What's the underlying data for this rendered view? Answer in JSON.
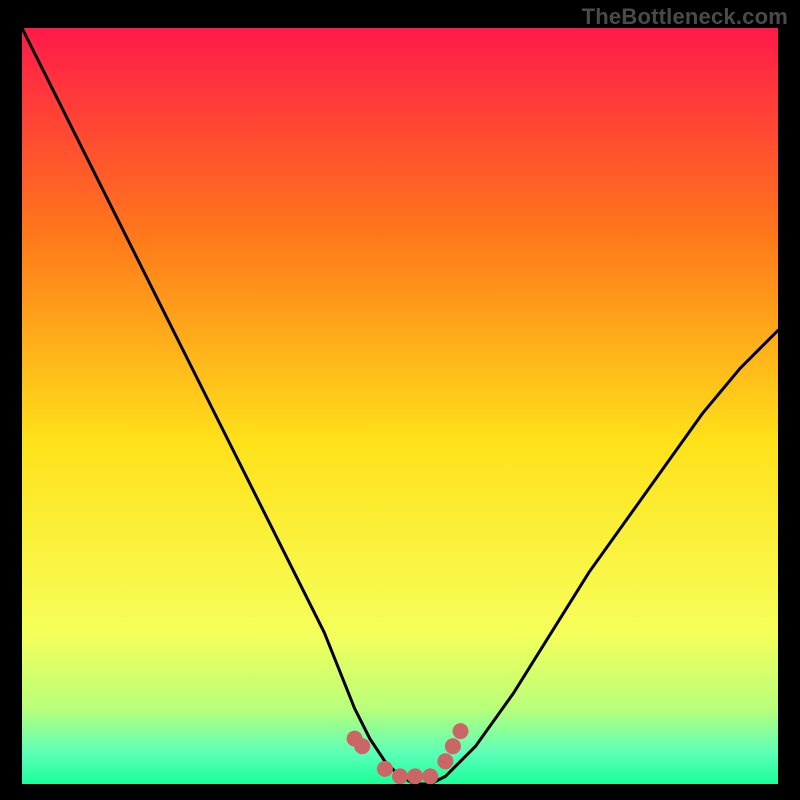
{
  "watermark": "TheBottleneck.com",
  "colors": {
    "frame": "#000000",
    "gradient_top": "#ff1a4a",
    "gradient_mid1": "#ff7a1a",
    "gradient_mid2": "#ffe21a",
    "gradient_low": "#f6ff5a",
    "gradient_green1": "#b8ff7a",
    "gradient_green2": "#5affb8",
    "gradient_bottom": "#1aff9a",
    "curve": "#000000",
    "marker": "#cc6666"
  },
  "chart_data": {
    "type": "line",
    "title": "",
    "xlabel": "",
    "ylabel": "",
    "xlim": [
      0,
      100
    ],
    "ylim": [
      0,
      100
    ],
    "grid": false,
    "series": [
      {
        "name": "bottleneck-curve",
        "x": [
          0,
          5,
          10,
          15,
          20,
          25,
          30,
          35,
          40,
          44,
          46,
          48,
          50,
          52,
          54,
          56,
          58,
          60,
          65,
          70,
          75,
          80,
          85,
          90,
          95,
          100
        ],
        "values": [
          100,
          90,
          80,
          70,
          60,
          50,
          40,
          30,
          20,
          10,
          6,
          3,
          1,
          0,
          0,
          1,
          3,
          5,
          12,
          20,
          28,
          35,
          42,
          49,
          55,
          60
        ]
      }
    ],
    "markers": {
      "name": "highlighted-points",
      "x": [
        44,
        45,
        48,
        50,
        52,
        54,
        56,
        57,
        58
      ],
      "values": [
        6,
        5,
        2,
        1,
        1,
        1,
        3,
        5,
        7
      ]
    },
    "legend": false
  }
}
